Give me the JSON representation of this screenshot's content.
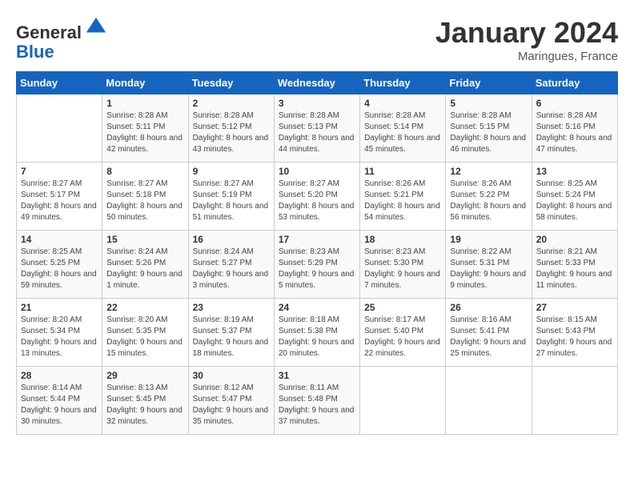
{
  "header": {
    "logo_line1": "General",
    "logo_line2": "Blue",
    "month_title": "January 2024",
    "location": "Maringues, France"
  },
  "days_of_week": [
    "Sunday",
    "Monday",
    "Tuesday",
    "Wednesday",
    "Thursday",
    "Friday",
    "Saturday"
  ],
  "weeks": [
    [
      {
        "day": "",
        "sunrise": "",
        "sunset": "",
        "daylight": ""
      },
      {
        "day": "1",
        "sunrise": "8:28 AM",
        "sunset": "5:11 PM",
        "daylight": "8 hours and 42 minutes."
      },
      {
        "day": "2",
        "sunrise": "8:28 AM",
        "sunset": "5:12 PM",
        "daylight": "8 hours and 43 minutes."
      },
      {
        "day": "3",
        "sunrise": "8:28 AM",
        "sunset": "5:13 PM",
        "daylight": "8 hours and 44 minutes."
      },
      {
        "day": "4",
        "sunrise": "8:28 AM",
        "sunset": "5:14 PM",
        "daylight": "8 hours and 45 minutes."
      },
      {
        "day": "5",
        "sunrise": "8:28 AM",
        "sunset": "5:15 PM",
        "daylight": "8 hours and 46 minutes."
      },
      {
        "day": "6",
        "sunrise": "8:28 AM",
        "sunset": "5:16 PM",
        "daylight": "8 hours and 47 minutes."
      }
    ],
    [
      {
        "day": "7",
        "sunrise": "8:27 AM",
        "sunset": "5:17 PM",
        "daylight": "8 hours and 49 minutes."
      },
      {
        "day": "8",
        "sunrise": "8:27 AM",
        "sunset": "5:18 PM",
        "daylight": "8 hours and 50 minutes."
      },
      {
        "day": "9",
        "sunrise": "8:27 AM",
        "sunset": "5:19 PM",
        "daylight": "8 hours and 51 minutes."
      },
      {
        "day": "10",
        "sunrise": "8:27 AM",
        "sunset": "5:20 PM",
        "daylight": "8 hours and 53 minutes."
      },
      {
        "day": "11",
        "sunrise": "8:26 AM",
        "sunset": "5:21 PM",
        "daylight": "8 hours and 54 minutes."
      },
      {
        "day": "12",
        "sunrise": "8:26 AM",
        "sunset": "5:22 PM",
        "daylight": "8 hours and 56 minutes."
      },
      {
        "day": "13",
        "sunrise": "8:25 AM",
        "sunset": "5:24 PM",
        "daylight": "8 hours and 58 minutes."
      }
    ],
    [
      {
        "day": "14",
        "sunrise": "8:25 AM",
        "sunset": "5:25 PM",
        "daylight": "8 hours and 59 minutes."
      },
      {
        "day": "15",
        "sunrise": "8:24 AM",
        "sunset": "5:26 PM",
        "daylight": "9 hours and 1 minute."
      },
      {
        "day": "16",
        "sunrise": "8:24 AM",
        "sunset": "5:27 PM",
        "daylight": "9 hours and 3 minutes."
      },
      {
        "day": "17",
        "sunrise": "8:23 AM",
        "sunset": "5:29 PM",
        "daylight": "9 hours and 5 minutes."
      },
      {
        "day": "18",
        "sunrise": "8:23 AM",
        "sunset": "5:30 PM",
        "daylight": "9 hours and 7 minutes."
      },
      {
        "day": "19",
        "sunrise": "8:22 AM",
        "sunset": "5:31 PM",
        "daylight": "9 hours and 9 minutes."
      },
      {
        "day": "20",
        "sunrise": "8:21 AM",
        "sunset": "5:33 PM",
        "daylight": "9 hours and 11 minutes."
      }
    ],
    [
      {
        "day": "21",
        "sunrise": "8:20 AM",
        "sunset": "5:34 PM",
        "daylight": "9 hours and 13 minutes."
      },
      {
        "day": "22",
        "sunrise": "8:20 AM",
        "sunset": "5:35 PM",
        "daylight": "9 hours and 15 minutes."
      },
      {
        "day": "23",
        "sunrise": "8:19 AM",
        "sunset": "5:37 PM",
        "daylight": "9 hours and 18 minutes."
      },
      {
        "day": "24",
        "sunrise": "8:18 AM",
        "sunset": "5:38 PM",
        "daylight": "9 hours and 20 minutes."
      },
      {
        "day": "25",
        "sunrise": "8:17 AM",
        "sunset": "5:40 PM",
        "daylight": "9 hours and 22 minutes."
      },
      {
        "day": "26",
        "sunrise": "8:16 AM",
        "sunset": "5:41 PM",
        "daylight": "9 hours and 25 minutes."
      },
      {
        "day": "27",
        "sunrise": "8:15 AM",
        "sunset": "5:43 PM",
        "daylight": "9 hours and 27 minutes."
      }
    ],
    [
      {
        "day": "28",
        "sunrise": "8:14 AM",
        "sunset": "5:44 PM",
        "daylight": "9 hours and 30 minutes."
      },
      {
        "day": "29",
        "sunrise": "8:13 AM",
        "sunset": "5:45 PM",
        "daylight": "9 hours and 32 minutes."
      },
      {
        "day": "30",
        "sunrise": "8:12 AM",
        "sunset": "5:47 PM",
        "daylight": "9 hours and 35 minutes."
      },
      {
        "day": "31",
        "sunrise": "8:11 AM",
        "sunset": "5:48 PM",
        "daylight": "9 hours and 37 minutes."
      },
      {
        "day": "",
        "sunrise": "",
        "sunset": "",
        "daylight": ""
      },
      {
        "day": "",
        "sunrise": "",
        "sunset": "",
        "daylight": ""
      },
      {
        "day": "",
        "sunrise": "",
        "sunset": "",
        "daylight": ""
      }
    ]
  ]
}
